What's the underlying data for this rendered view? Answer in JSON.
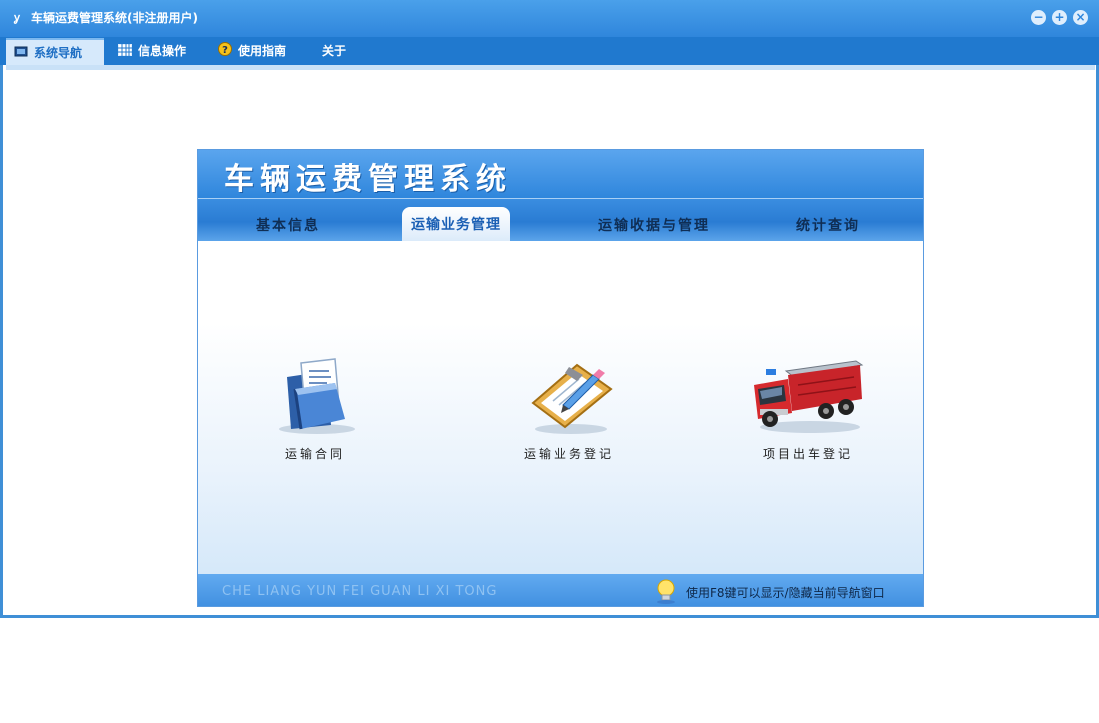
{
  "window": {
    "title": "车辆运费管理系统(非注册用户)",
    "controls": [
      "minimize",
      "maximize",
      "close"
    ]
  },
  "menu": [
    {
      "label": "系统导航",
      "icon": "monitor-icon",
      "active": true
    },
    {
      "label": "信息操作",
      "icon": "grid-icon",
      "active": false
    },
    {
      "label": "使用指南",
      "icon": "help-icon",
      "active": false
    },
    {
      "label": "关于",
      "icon": "",
      "active": false
    }
  ],
  "panel": {
    "title": "车辆运费管理系统",
    "tabs": [
      {
        "label": "基本信息",
        "active": false
      },
      {
        "label": "运输业务管理",
        "active": true
      },
      {
        "label": "运输收据与管理",
        "active": false
      },
      {
        "label": "统计查询",
        "active": false
      }
    ],
    "items": [
      {
        "label": "运输合同",
        "icon": "document-folder-icon"
      },
      {
        "label": "运输业务登记",
        "icon": "clipboard-pen-icon"
      },
      {
        "label": "项目出车登记",
        "icon": "fire-truck-icon"
      }
    ],
    "footer_text": "CHE LIANG YUN FEI GUAN LI XI TONG",
    "tip_text": "使用F8键可以显示/隐藏当前导航窗口"
  },
  "colors": {
    "titlebar": "#3f8fd6",
    "menubar": "#2079cf",
    "panel_header": "#2f86dc"
  }
}
